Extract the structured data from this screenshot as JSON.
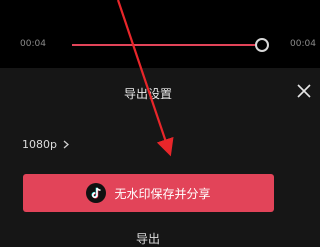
{
  "player": {
    "current_time": "00:04",
    "total_time": "00:04",
    "progress": 1.0,
    "accent_color": "#e24459"
  },
  "export_sheet": {
    "title": "导出设置",
    "resolution": "1080p",
    "share_button_label": "无水印保存并分享",
    "export_label": "导出",
    "close_icon": "close-icon",
    "share_icon": "tiktok-logo-icon"
  },
  "annotation": {
    "arrow_color": "#e8262a"
  }
}
